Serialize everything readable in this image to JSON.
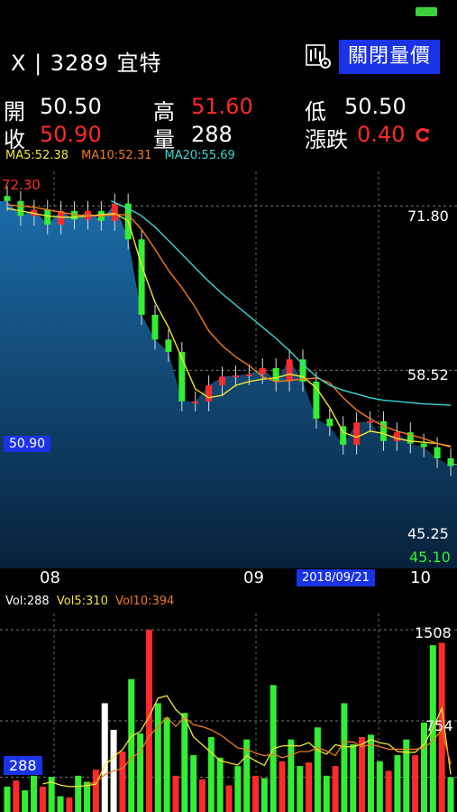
{
  "app": {
    "title": "X | 3289 宜特",
    "close_price_volume_label": "關閉量價"
  },
  "quote": {
    "open_label": "開",
    "open": "50.50",
    "high_label": "高",
    "high": "51.60",
    "low_label": "低",
    "low": "50.50",
    "close_label": "收",
    "close": "50.90",
    "volume_label": "量",
    "volume": "288",
    "change_label": "漲跌",
    "change": "0.40"
  },
  "ma": {
    "ma5": "MA5:52.38",
    "ma10": "MA10:52.31",
    "ma20": "MA20:55.69"
  },
  "price_axis": {
    "max_label": "72.30",
    "upper_label": "71.80",
    "mid_label": "58.52",
    "current_label": "50.90",
    "lower_label": "45.25",
    "min_label": "45.10"
  },
  "date_axis": {
    "d1": "08",
    "d2": "09",
    "selected_date": "2018/09/21",
    "d3": "10"
  },
  "volume": {
    "vol": "Vol:288",
    "vol5": "Vol5:310",
    "vol10": "Vol10:394",
    "max_label": "1508",
    "mid_label": "754",
    "current_label": "288"
  },
  "colors": {
    "up": "#ff2a2a",
    "down": "#33ee33",
    "ma5": "#f2e630",
    "ma10": "#f07c1e",
    "ma20": "#39d6d6",
    "accent": "#1a33e6"
  },
  "chart_data": [
    {
      "type": "line",
      "title": "",
      "series": [
        {
          "name": "MA5",
          "values": [
            71.6,
            71.4,
            71.2,
            71.0,
            70.9,
            70.9,
            71.0,
            71.1,
            71.2,
            70.6,
            67.0,
            64.0,
            62.0,
            59.5,
            57.0,
            56.3,
            56.5,
            57.3,
            57.6,
            57.8,
            57.9,
            58.2,
            58.0,
            57.1,
            55.5,
            53.5,
            53.1,
            53.6,
            53.4,
            53.0,
            52.8,
            52.7,
            52.6,
            52.38
          ]
        },
        {
          "name": "MA10",
          "values": [
            71.9,
            71.8,
            71.7,
            71.5,
            71.3,
            71.1,
            71.0,
            71.0,
            71.1,
            71.1,
            69.9,
            68.3,
            66.6,
            65.2,
            63.6,
            61.7,
            60.5,
            59.6,
            58.9,
            58.0,
            57.6,
            57.7,
            57.8,
            57.9,
            57.5,
            56.3,
            55.3,
            54.6,
            54.0,
            53.6,
            53.3,
            53.0,
            52.6,
            52.31
          ]
        },
        {
          "name": "MA20",
          "values": [
            null,
            null,
            null,
            null,
            null,
            null,
            null,
            null,
            null,
            71.6,
            71.0,
            70.1,
            69.0,
            67.9,
            66.8,
            65.7,
            64.7,
            63.8,
            62.9,
            62.0,
            61.1,
            60.1,
            59.0,
            58.0,
            57.3,
            56.9,
            56.6,
            56.3,
            56.1,
            56.0,
            55.9,
            55.8,
            55.75,
            55.69
          ]
        }
      ]
    },
    {
      "type": "bar",
      "title": "",
      "series": [
        {
          "name": "Vol",
          "values": [
            210,
            260,
            180,
            300,
            210,
            290,
            130,
            120,
            300,
            250,
            350,
            900,
            680,
            500,
            1100,
            650,
            1508,
            900,
            780,
            300,
            820,
            470,
            270,
            620,
            450,
            220,
            380,
            600,
            300,
            280,
            1050,
            420,
            600,
            380,
            410,
            700,
            300,
            380,
            900,
            560,
            620,
            640,
            420,
            340,
            470,
            600,
            470,
            740,
            1380,
            1400,
            288
          ]
        },
        {
          "name": "Vol5",
          "values": [
            null,
            null,
            null,
            null,
            232,
            248,
            222,
            210,
            212,
            218,
            230,
            384,
            456,
            516,
            626,
            666,
            788,
            942,
            962,
            848,
            782,
            622,
            556,
            492,
            426,
            406,
            388,
            468,
            422,
            386,
            524,
            546,
            550,
            546,
            574,
            512,
            478,
            556,
            540,
            540,
            560,
            600,
            574,
            560,
            500,
            494,
            494,
            562,
            690,
            858,
            310
          ]
        },
        {
          "name": "Vol10",
          "values": [
            null,
            null,
            null,
            null,
            null,
            null,
            null,
            null,
            null,
            231,
            245,
            309,
            340,
            360,
            446,
            494,
            630,
            702,
            785,
            708,
            783,
            722,
            706,
            680,
            640,
            586,
            530,
            518,
            488,
            466,
            480,
            450,
            470,
            500,
            500,
            533,
            505,
            467,
            583,
            580,
            540,
            560,
            540,
            520,
            520,
            520,
            520,
            530,
            590,
            680,
            394
          ]
        }
      ]
    }
  ]
}
